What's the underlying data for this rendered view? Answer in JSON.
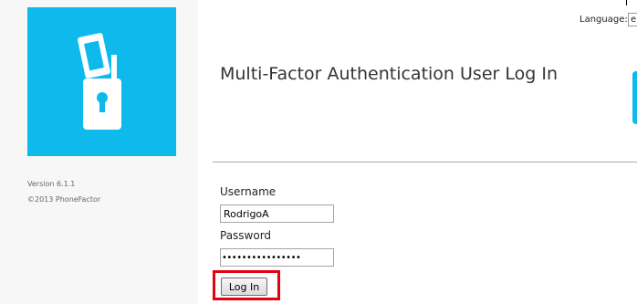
{
  "sidebar": {
    "version": "Version 6.1.1",
    "copyright": "©2013 PhoneFactor",
    "logo_icon": "phone-padlock-icon",
    "accent_color": "#0dbaeb"
  },
  "header": {
    "language_label": "Language:",
    "language_value": "e"
  },
  "main": {
    "title": "Multi-Factor Authentication User Log In",
    "username_label": "Username",
    "username_value": "RodrigoA",
    "password_label": "Password",
    "password_value": "••••••••••••••••",
    "login_label": "Log In",
    "highlight_color": "#e3000f"
  }
}
